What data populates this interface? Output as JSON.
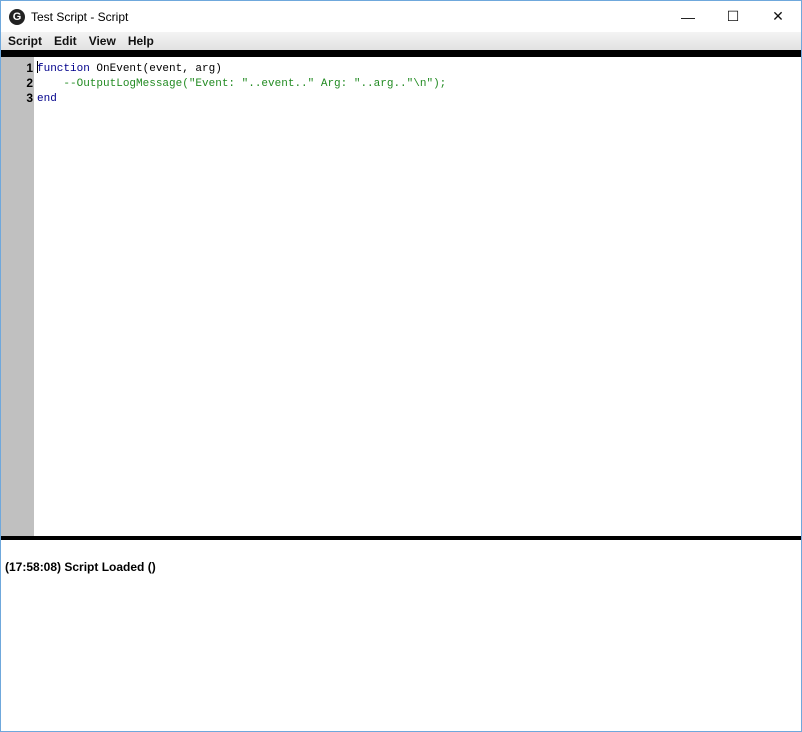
{
  "window": {
    "title": "Test Script - Script",
    "minimize": "—",
    "maximize": "☐",
    "close": "✕",
    "icon": "G"
  },
  "menu": [
    "Script",
    "Edit",
    "View",
    "Help"
  ],
  "editor": {
    "line_numbers": [
      "1",
      "2",
      "3"
    ],
    "lines": [
      [
        {
          "t": "function",
          "c": "kw"
        },
        {
          "t": " OnEvent(event, arg)",
          "c": "tx"
        }
      ],
      [
        {
          "t": "    --OutputLogMessage(\"Event: \"..event..\" Arg: \"..arg..\"\\n\");",
          "c": "cm"
        }
      ],
      [
        {
          "t": "end",
          "c": "kw"
        }
      ]
    ]
  },
  "log": {
    "entries": [
      "(17:58:08) Script Loaded ()"
    ]
  }
}
